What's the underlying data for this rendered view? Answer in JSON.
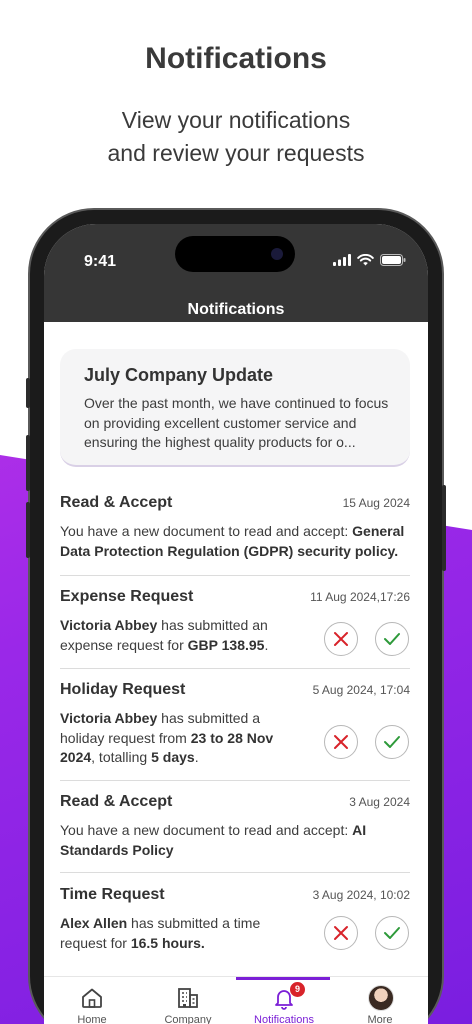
{
  "promo": {
    "title": "Notifications",
    "subtitle_line1": "View your notifications",
    "subtitle_line2": "and review your requests"
  },
  "status_bar": {
    "time": "9:41"
  },
  "header": {
    "title": "Notifications"
  },
  "announcement": {
    "title": "July Company Update",
    "text": "Over the past month, we have continued to focus on providing excellent customer service and ensuring the highest quality products for o..."
  },
  "notifications": [
    {
      "title": "Read & Accept",
      "date": "15 Aug 2024",
      "body_pre": "You have a new document to read and accept: ",
      "body_bold": "General Data Protection Regulation (GDPR) security policy."
    },
    {
      "title": "Expense Request",
      "date": "11 Aug 2024,17:26",
      "name": "Victoria Abbey",
      "body_mid": " has submitted an expense request for ",
      "amount": "GBP 138.95",
      "body_end": "."
    },
    {
      "title": "Holiday Request",
      "date": "5 Aug 2024, 17:04",
      "name": "Victoria Abbey",
      "body_mid": " has submitted a holiday request from ",
      "range": "23 to 28 Nov 2024",
      "body_mid2": ", totalling ",
      "days": "5 days",
      "body_end": "."
    },
    {
      "title": "Read & Accept",
      "date": "3 Aug 2024",
      "body_pre": "You have a new document to read and accept: ",
      "body_bold": "AI Standards Policy"
    },
    {
      "title": "Time Request",
      "date": "3 Aug 2024, 10:02",
      "name": "Alex Allen",
      "body_mid": " has submitted a time request for ",
      "hours": "16.5 hours.",
      "body_end": ""
    }
  ],
  "tabs": [
    {
      "label": "Home",
      "icon": "home-icon"
    },
    {
      "label": "Company",
      "icon": "building-icon"
    },
    {
      "label": "Notifications",
      "icon": "bell-icon",
      "badge": "9",
      "active": true
    },
    {
      "label": "More",
      "icon": "avatar"
    }
  ],
  "colors": {
    "accent": "#7b1fd6",
    "reject": "#d8232a",
    "accept": "#2e9a3a",
    "header_bg": "#363636"
  }
}
